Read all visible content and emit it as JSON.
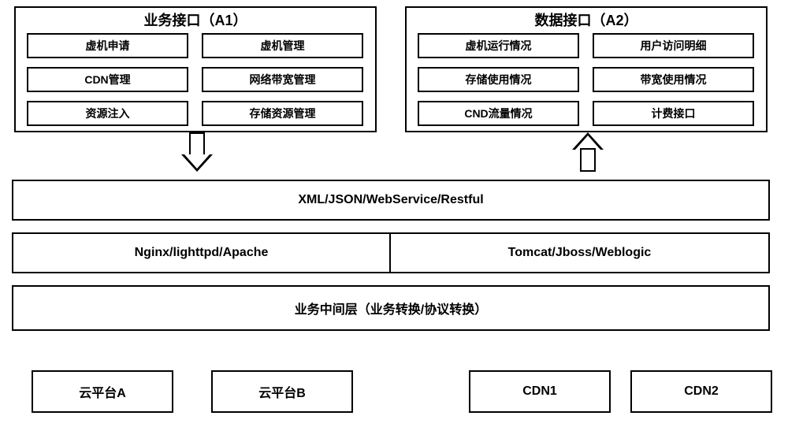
{
  "groups": {
    "a1": {
      "title": "业务接口（A1）",
      "items": [
        [
          "虚机申请",
          "虚机管理"
        ],
        [
          "CDN管理",
          "网络带宽管理"
        ],
        [
          "资源注入",
          "存储资源管理"
        ]
      ]
    },
    "a2": {
      "title": "数据接口（A2）",
      "items": [
        [
          "虚机运行情况",
          "用户访问明细"
        ],
        [
          "存储使用情况",
          "带宽使用情况"
        ],
        [
          "CND流量情况",
          "计费接口"
        ]
      ]
    }
  },
  "layers": {
    "protocol": "XML/JSON/WebService/Restful",
    "servers_left": "Nginx/lighttpd/Apache",
    "servers_right": "Tomcat/Jboss/Weblogic",
    "middle": "业务中间层（业务转换/协议转换）"
  },
  "platforms": {
    "cloud_a": "云平台A",
    "cloud_b": "云平台B",
    "cdn1": "CDN1",
    "cdn2": "CDN2"
  }
}
